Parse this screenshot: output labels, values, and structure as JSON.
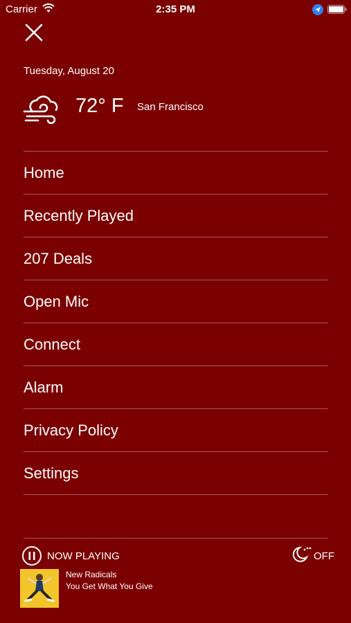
{
  "status_bar": {
    "carrier": "Carrier",
    "time": "2:35 PM"
  },
  "header": {
    "date": "Tuesday, August 20",
    "temperature": "72° F",
    "city": "San Francisco",
    "weather_icon": "windy-cloud-icon"
  },
  "menu": {
    "items": [
      {
        "label": "Home"
      },
      {
        "label": "Recently Played"
      },
      {
        "label": "207 Deals"
      },
      {
        "label": "Open Mic"
      },
      {
        "label": "Connect"
      },
      {
        "label": "Alarm"
      },
      {
        "label": "Privacy Policy"
      },
      {
        "label": "Settings"
      }
    ]
  },
  "now_playing": {
    "label": "NOW PLAYING",
    "sleep_label": "OFF",
    "artist": "New Radicals",
    "song": "You Get What You Give"
  },
  "colors": {
    "background": "#7b0000",
    "text": "#ffffff",
    "album_background": "#f2c52a"
  }
}
